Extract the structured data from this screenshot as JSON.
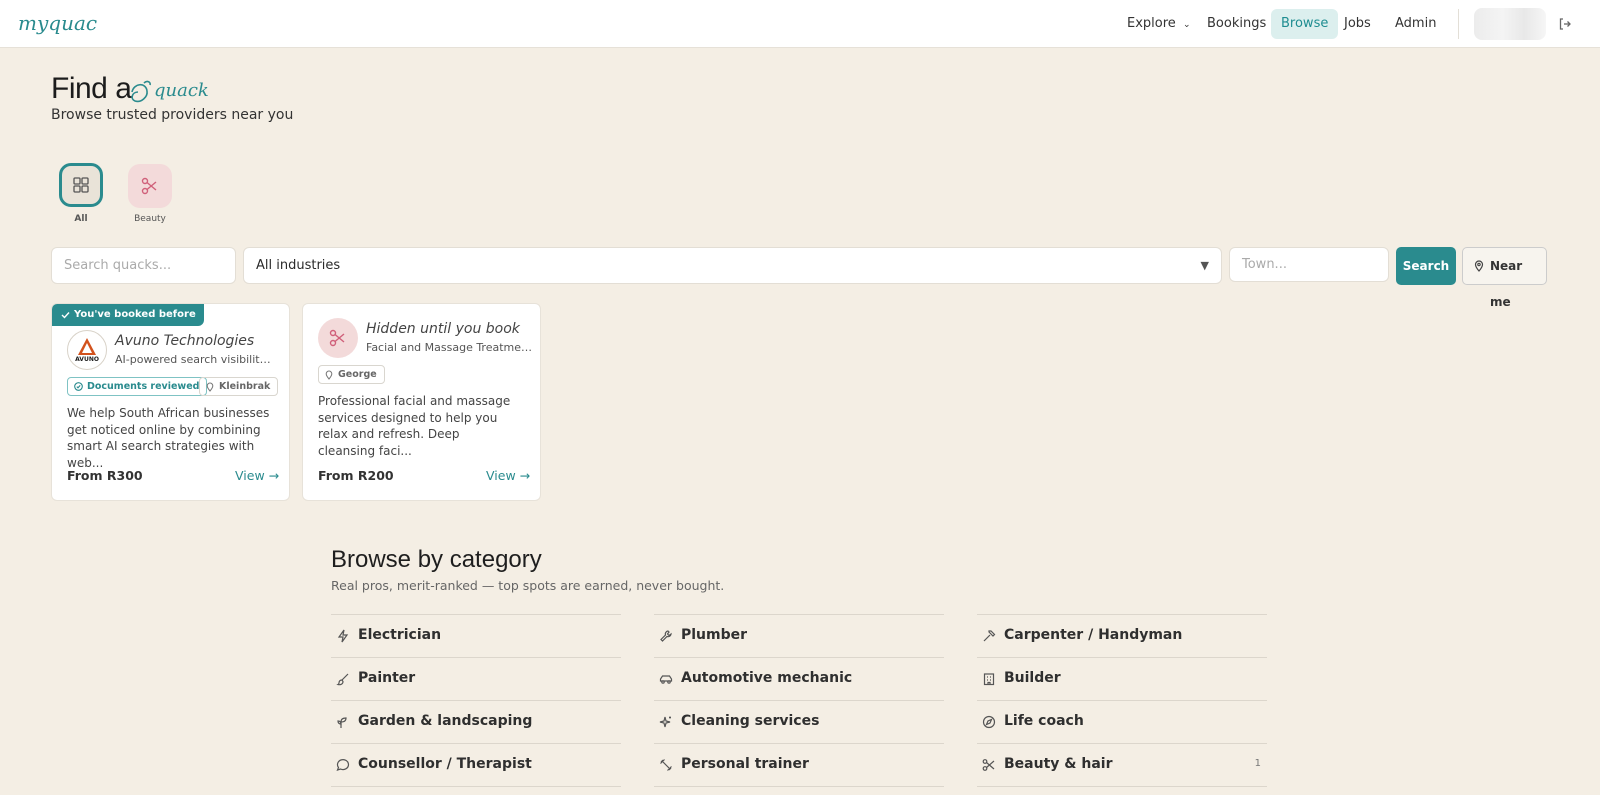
{
  "header": {
    "logo_text": "myquack",
    "nav": [
      {
        "label": "Explore",
        "dropdown": true
      },
      {
        "label": "Bookings"
      },
      {
        "label": "Browse",
        "active": true
      },
      {
        "label": "Jobs"
      },
      {
        "label": "Admin"
      }
    ],
    "logout_icon": "logout-icon"
  },
  "hero": {
    "title": "Find a",
    "title_logo": "quack",
    "subtitle": "Browse trusted providers near you"
  },
  "categories_top": [
    {
      "label": "All",
      "icon": "grid-icon",
      "selected": true
    },
    {
      "label": "Beauty",
      "icon": "scissors-icon"
    }
  ],
  "search": {
    "query_placeholder": "Search quacks...",
    "industry_value": "All industries",
    "town_placeholder": "Town...",
    "search_button": "Search",
    "near_me_button": "Near me"
  },
  "cards": [
    {
      "ribbon": "You've booked before",
      "title": "Avuno Technologies",
      "subtitle": "AI-powered search visibility ...",
      "avatar_text": "AVUNO",
      "badges": [
        "Documents reviewed",
        "Kleinbrak"
      ],
      "description": "We help South African businesses get noticed online by combining smart AI search strategies with web...",
      "price": "From R300",
      "view": "View →"
    },
    {
      "title": "Hidden until you book",
      "subtitle": "Facial and Massage Treatments",
      "badges": [
        "George"
      ],
      "description": "Professional facial and massage services designed to help you relax and refresh. Deep cleansing faci...",
      "price": "From R200",
      "view": "View →"
    }
  ],
  "browse": {
    "title": "Browse by category",
    "subtitle": "Real pros, merit-ranked — top spots are earned, never bought.",
    "items": [
      {
        "label": "Electrician",
        "icon": "lightning-icon"
      },
      {
        "label": "Plumber",
        "icon": "wrench-icon"
      },
      {
        "label": "Carpenter / Handyman",
        "icon": "hammer-icon"
      },
      {
        "label": "Painter",
        "icon": "paintbrush-icon"
      },
      {
        "label": "Automotive mechanic",
        "icon": "car-icon"
      },
      {
        "label": "Builder",
        "icon": "building-icon"
      },
      {
        "label": "Garden & landscaping",
        "icon": "sprout-icon"
      },
      {
        "label": "Cleaning services",
        "icon": "sparkles-icon"
      },
      {
        "label": "Life coach",
        "icon": "compass-icon"
      },
      {
        "label": "Counsellor / Therapist",
        "icon": "chat-icon"
      },
      {
        "label": "Personal trainer",
        "icon": "dumbbell-icon"
      },
      {
        "label": "Beauty & hair",
        "icon": "scissors-icon",
        "count": "1"
      }
    ]
  },
  "colors": {
    "accent": "#2a8b8e",
    "background": "#f4eee4",
    "nav_active_bg": "#dcefee",
    "beauty_chip": "#f3dada"
  }
}
